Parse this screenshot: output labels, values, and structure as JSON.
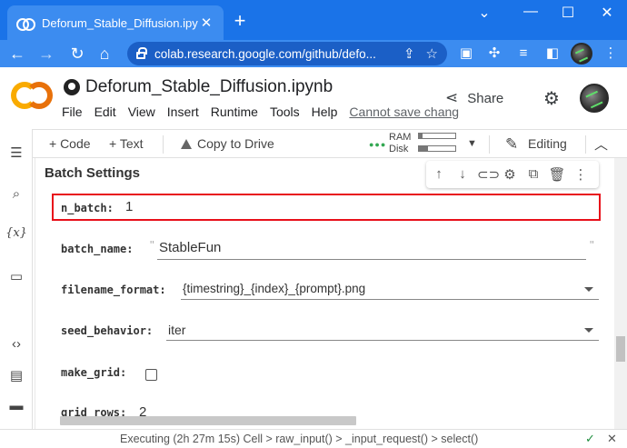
{
  "browser": {
    "tab_title": "Deforum_Stable_Diffusion.ipynb",
    "tab_close": "✕",
    "new_tab": "+",
    "url": "colab.research.google.com/github/defo...",
    "window_controls": [
      "⌄",
      "—",
      "☐",
      "✕"
    ]
  },
  "colab": {
    "notebook_title": "Deforum_Stable_Diffusion.ipynb",
    "menu": [
      "File",
      "Edit",
      "View",
      "Insert",
      "Runtime",
      "Tools",
      "Help"
    ],
    "unsaved_notice": "Cannot save chang",
    "share_label": "Share"
  },
  "toolbar": {
    "add_code": "+ Code",
    "add_text": "+ Text",
    "copy_to_drive": "Copy to Drive",
    "ram_label": "RAM",
    "disk_label": "Disk",
    "ram_usage": 0.1,
    "disk_usage": 0.25,
    "editing_label": "Editing"
  },
  "cell": {
    "heading": "Batch Settings",
    "params": [
      {
        "name": "n_batch:",
        "value": "1",
        "kind": "number"
      },
      {
        "name": "batch_name:",
        "value": "StableFun",
        "kind": "text"
      },
      {
        "name": "filename_format:",
        "value": "{timestring}_{index}_{prompt}.png",
        "kind": "dropdown"
      },
      {
        "name": "seed_behavior:",
        "value": "iter",
        "kind": "dropdown"
      },
      {
        "name": "make_grid:",
        "value": "",
        "kind": "checkbox",
        "checked": false
      },
      {
        "name": "grid_rows:",
        "value": "2",
        "kind": "number"
      }
    ]
  },
  "status": {
    "text": "Executing (2h 27m 15s)  Cell > raw_input() > _input_request() > select()",
    "ok_icon": "✓",
    "close_icon": "✕"
  },
  "colors": {
    "chrome_blue": "#1a73e8",
    "highlight_red": "#e8101a",
    "logo_orange": "#f9ab00"
  }
}
